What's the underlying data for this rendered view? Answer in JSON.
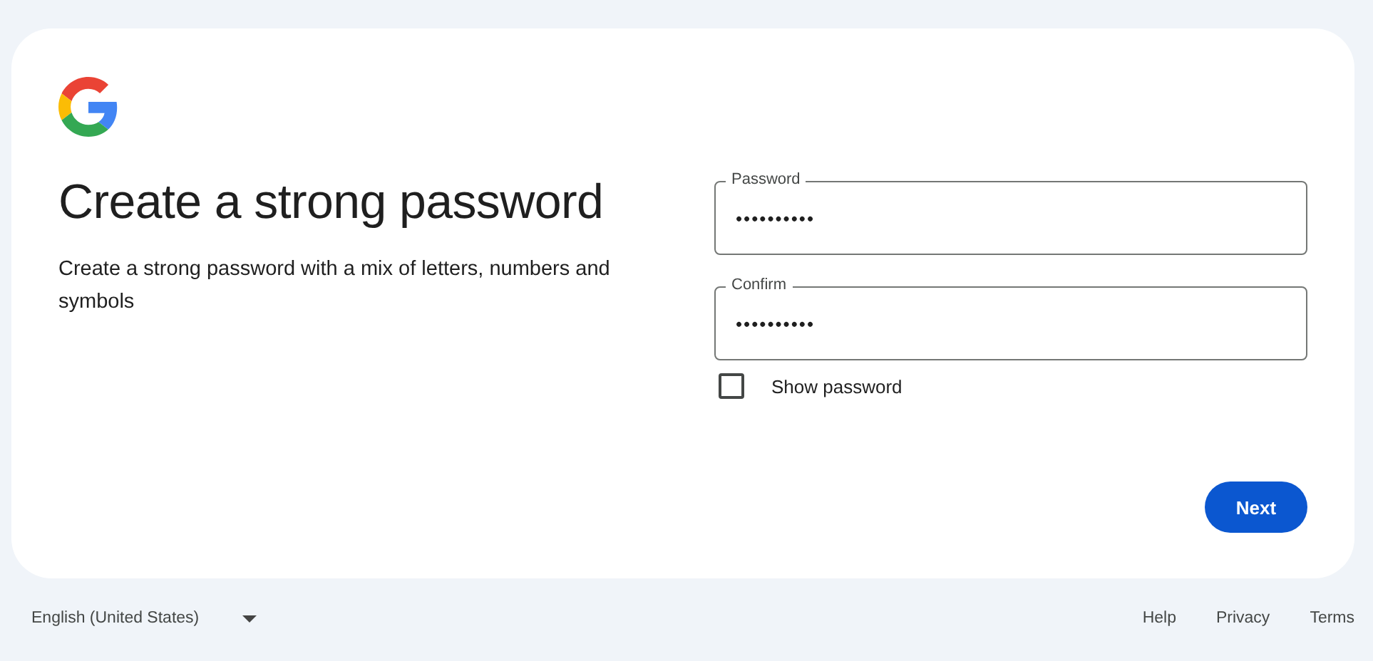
{
  "card": {
    "title": "Create a strong password",
    "subtitle": "Create a strong password with a mix of letters, numbers and symbols",
    "fields": [
      {
        "label": "Password",
        "value": "••••••••••"
      },
      {
        "label": "Confirm",
        "value": "••••••••••"
      }
    ],
    "show_password": {
      "label": "Show password",
      "checked": false
    },
    "next_button": "Next"
  },
  "footer": {
    "language": "English (United States)",
    "links": [
      "Help",
      "Privacy",
      "Terms"
    ]
  }
}
